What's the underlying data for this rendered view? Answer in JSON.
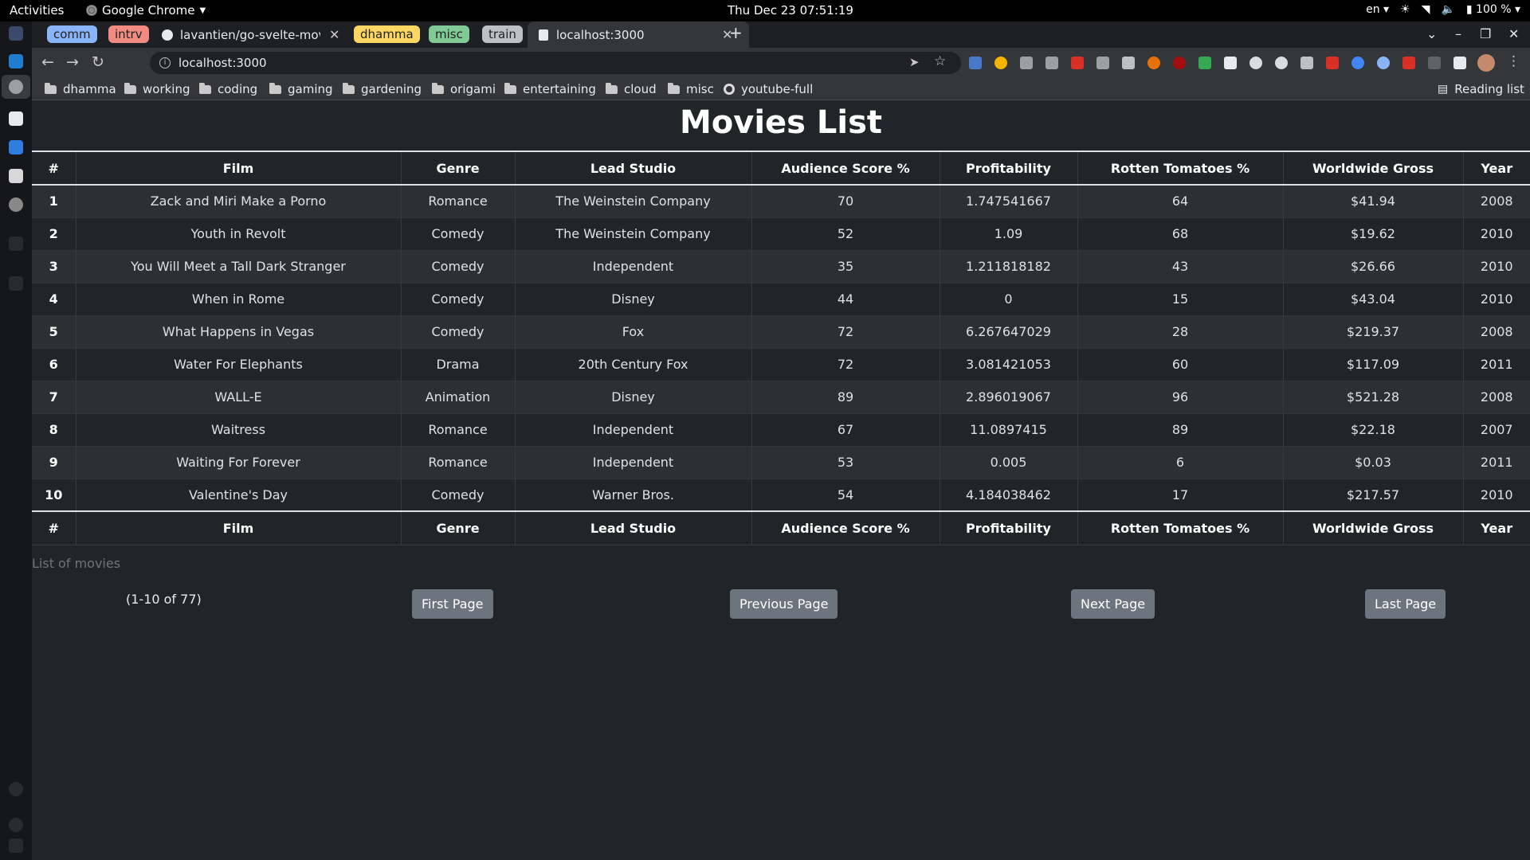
{
  "system_bar": {
    "activities": "Activities",
    "app_name": "Google Chrome",
    "clock": "Thu Dec 23  07:51:19",
    "lang": "en",
    "battery": "100 %"
  },
  "tabs": {
    "groups": [
      {
        "label": "comm",
        "color": "#8ab4f8"
      },
      {
        "label": "intrv",
        "color": "#f28b82"
      },
      {
        "label": "dhamma",
        "color": "#fdd663"
      },
      {
        "label": "misc",
        "color": "#81c995"
      },
      {
        "label": "train",
        "color": "#bdc1c6"
      }
    ],
    "github_tab_title": "lavantien/go-svelte-movie",
    "active_tab_title": "localhost:3000"
  },
  "address_bar": {
    "url": "localhost:3000"
  },
  "bookmarks": {
    "items": [
      "dhamma",
      "working",
      "coding",
      "gaming",
      "gardening",
      "origami",
      "entertaining",
      "cloud",
      "misc",
      "youtube-full"
    ],
    "reading_list": "Reading list"
  },
  "page": {
    "title": "Movies List",
    "caption": "List of movies",
    "range_text": "(1-10 of 77)",
    "buttons": {
      "first": "First Page",
      "previous": "Previous Page",
      "next": "Next Page",
      "last": "Last Page"
    }
  },
  "table": {
    "columns": [
      "#",
      "Film",
      "Genre",
      "Lead Studio",
      "Audience Score %",
      "Profitability",
      "Rotten Tomatoes %",
      "Worldwide Gross",
      "Year"
    ],
    "rows": [
      [
        "1",
        "Zack and Miri Make a Porno",
        "Romance",
        "The Weinstein Company",
        "70",
        "1.747541667",
        "64",
        "$41.94",
        "2008"
      ],
      [
        "2",
        "Youth in Revolt",
        "Comedy",
        "The Weinstein Company",
        "52",
        "1.09",
        "68",
        "$19.62",
        "2010"
      ],
      [
        "3",
        "You Will Meet a Tall Dark Stranger",
        "Comedy",
        "Independent",
        "35",
        "1.211818182",
        "43",
        "$26.66",
        "2010"
      ],
      [
        "4",
        "When in Rome",
        "Comedy",
        "Disney",
        "44",
        "0",
        "15",
        "$43.04",
        "2010"
      ],
      [
        "5",
        "What Happens in Vegas",
        "Comedy",
        "Fox",
        "72",
        "6.267647029",
        "28",
        "$219.37",
        "2008"
      ],
      [
        "6",
        "Water For Elephants",
        "Drama",
        "20th Century Fox",
        "72",
        "3.081421053",
        "60",
        "$117.09",
        "2011"
      ],
      [
        "7",
        "WALL-E",
        "Animation",
        "Disney",
        "89",
        "2.896019067",
        "96",
        "$521.28",
        "2008"
      ],
      [
        "8",
        "Waitress",
        "Romance",
        "Independent",
        "67",
        "11.0897415",
        "89",
        "$22.18",
        "2007"
      ],
      [
        "9",
        "Waiting For Forever",
        "Romance",
        "Independent",
        "53",
        "0.005",
        "6",
        "$0.03",
        "2011"
      ],
      [
        "10",
        "Valentine's Day",
        "Comedy",
        "Warner Bros.",
        "54",
        "4.184038462",
        "17",
        "$217.57",
        "2010"
      ]
    ]
  }
}
